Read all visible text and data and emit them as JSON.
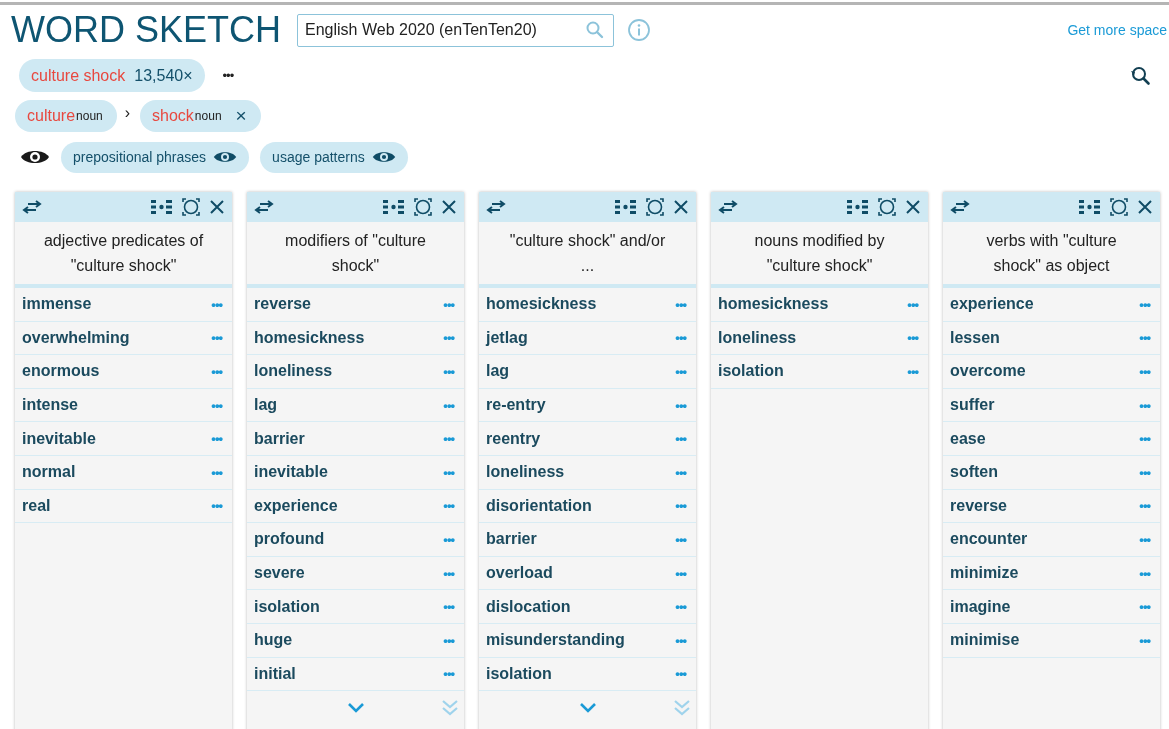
{
  "header": {
    "title": "WORD SKETCH",
    "corpus": "English Web 2020 (enTenTen20)",
    "more_space_link": "Get more space"
  },
  "query": {
    "phrase": "culture shock",
    "frequency": "13,540×",
    "more": "•••"
  },
  "lemmas": [
    {
      "word": "culture",
      "pos": "noun",
      "removable": false
    },
    {
      "word": "shock",
      "pos": "noun",
      "removable": true
    }
  ],
  "separator": "›",
  "remove_symbol": "×",
  "toggles": [
    {
      "label": "prepositional phrases",
      "visible": true
    },
    {
      "label": "usage patterns",
      "visible": true
    }
  ],
  "row_menu": "•••",
  "columns": [
    {
      "title": "adjective predicates of \"culture shock\"",
      "has_more": false,
      "rows": [
        "immense",
        "overwhelming",
        "enormous",
        "intense",
        "inevitable",
        "normal",
        "real"
      ]
    },
    {
      "title": "modifiers of \"culture shock\"",
      "has_more": true,
      "rows": [
        "reverse",
        "homesickness",
        "loneliness",
        "lag",
        "barrier",
        "inevitable",
        "experience",
        "profound",
        "severe",
        "isolation",
        "huge",
        "initial"
      ]
    },
    {
      "title": "\"culture shock\" and/or ...",
      "has_more": true,
      "rows": [
        "homesickness",
        "jetlag",
        "lag",
        "re-entry",
        "reentry",
        "loneliness",
        "disorientation",
        "barrier",
        "overload",
        "dislocation",
        "misunderstanding",
        "isolation"
      ]
    },
    {
      "title": "nouns modified by \"culture shock\"",
      "has_more": false,
      "rows": [
        "homesickness",
        "loneliness",
        "isolation"
      ]
    },
    {
      "title": "verbs with \"culture shock\" as object",
      "has_more": false,
      "rows": [
        "experience",
        "lessen",
        "overcome",
        "suffer",
        "ease",
        "soften",
        "reverse",
        "encounter",
        "minimize",
        "imagine",
        "minimise"
      ]
    }
  ]
}
